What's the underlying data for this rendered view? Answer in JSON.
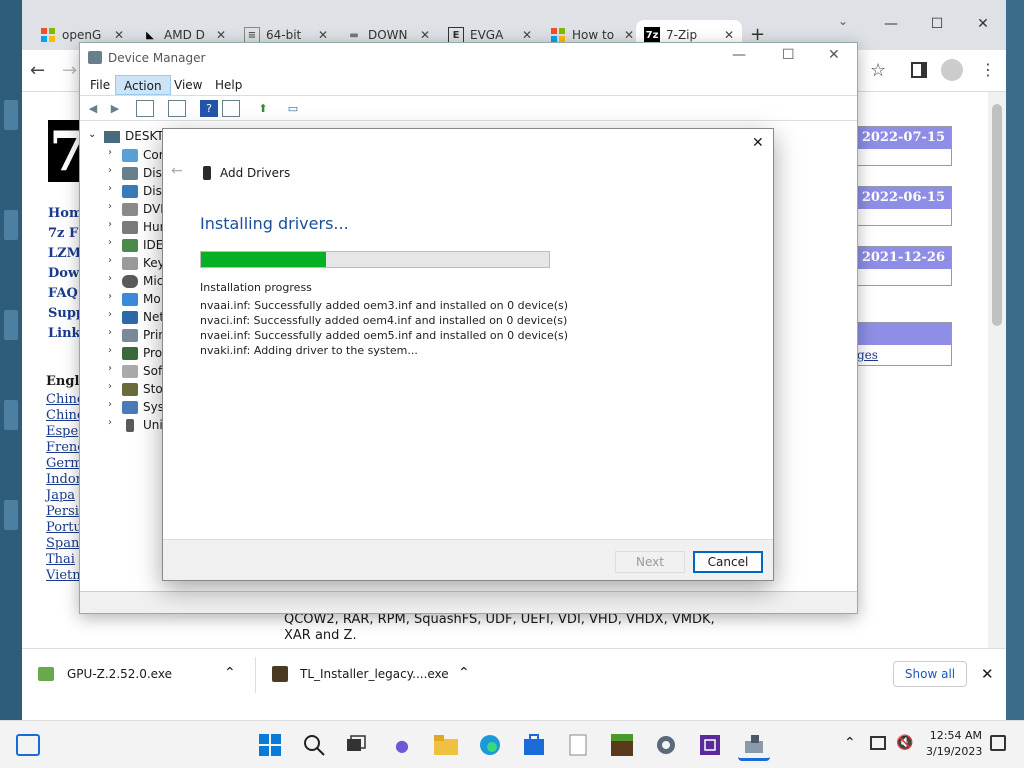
{
  "browser": {
    "tabs": [
      {
        "label": "openG",
        "favicon": "windows-logo"
      },
      {
        "label": "AMD D",
        "favicon": "amd-logo"
      },
      {
        "label": "64-bit",
        "favicon": "notepad-icon"
      },
      {
        "label": "DOWN",
        "favicon": "site-icon"
      },
      {
        "label": "EVGA",
        "favicon": "evga-logo"
      },
      {
        "label": "How to",
        "favicon": "windows-logo"
      },
      {
        "label": "7-Zip",
        "favicon": "7zip-logo"
      }
    ],
    "new_tab": "+",
    "window_controls": {
      "minimize": "—",
      "maximize": "☐",
      "close": "✕"
    }
  },
  "site": {
    "logo": "7",
    "nav": [
      "Hom",
      "7z F",
      "LZM",
      "Dow",
      "FAQ",
      "Supp",
      "Link"
    ],
    "lang_heading": "Engl",
    "languages": [
      "Chine",
      "Chine",
      "Espe",
      "Frenc",
      "Germ",
      "Indor",
      "Japa",
      "Persi",
      "Portu",
      "Span",
      "Thai",
      "Vietn"
    ],
    "dates": [
      "2022-07-15",
      "2022-06-15",
      "2021-12-26"
    ],
    "side_link": "ges",
    "body_text_1": "QCOW2, RAR, RPM, SquashFS, UDF, UEFI, VDI, VHD, VHDX, VMDK,",
    "body_text_2": "XAR and Z."
  },
  "device_manager": {
    "title": "Device Manager",
    "menus": [
      "File",
      "Action",
      "View",
      "Help"
    ],
    "root": "DESKTO",
    "tree": [
      "Cor",
      "Disk",
      "Disp",
      "DVD",
      "Hum",
      "IDE",
      "Key",
      "Mic",
      "Mo",
      "Net",
      "Prin",
      "Pro",
      "Soft",
      "Sto",
      "Syst",
      "Uni"
    ]
  },
  "dialog": {
    "header": "Add Drivers",
    "heading": "Installing drivers...",
    "progress_percent": 36,
    "progress_label": "Installation progress",
    "log": [
      "nvaai.inf: Successfully added oem3.inf and installed on 0 device(s)",
      "nvaci.inf: Successfully added oem4.inf and installed on 0 device(s)",
      "nvaei.inf: Successfully added oem5.inf and installed on 0 device(s)",
      "nvaki.inf: Adding driver to the system..."
    ],
    "next": "Next",
    "cancel": "Cancel",
    "close": "✕",
    "back": "←"
  },
  "downloads": {
    "items": [
      "GPU-Z.2.52.0.exe",
      "TL_Installer_legacy....exe"
    ],
    "show_all": "Show all",
    "close": "✕"
  },
  "taskbar": {
    "time": "12:54 AM",
    "date": "3/19/2023"
  }
}
